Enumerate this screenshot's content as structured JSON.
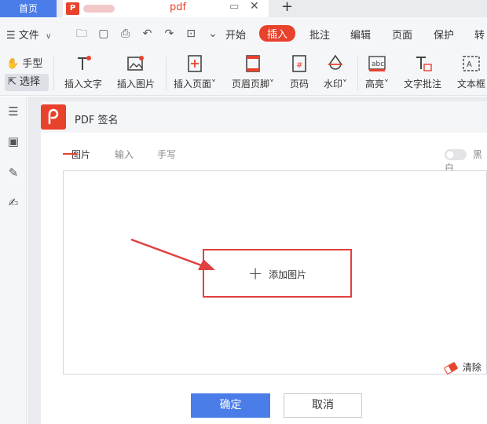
{
  "tabs": {
    "home": "首页",
    "doc_badge": "P",
    "doc_name": "pdf",
    "new_tab": "+"
  },
  "toolbar": {
    "file_menu": "文件",
    "menu_tabs": [
      "开始",
      "插入",
      "批注",
      "编辑",
      "页面",
      "保护",
      "转"
    ],
    "active_tab": "插入"
  },
  "tools": {
    "hand": "手型",
    "select": "选择",
    "items": [
      "插入文字",
      "插入图片",
      "插入页面",
      "页眉页脚",
      "页码",
      "水印",
      "高亮",
      "文字批注",
      "文本框"
    ]
  },
  "dialog": {
    "title": "PDF 签名",
    "tabs": [
      "图片",
      "输入",
      "手写"
    ],
    "toggle_label": "黑白",
    "add_image": "添加图片",
    "clear": "清除",
    "confirm": "确定",
    "cancel": "取消"
  },
  "colors": {
    "accent_red": "#e8412c",
    "primary_blue": "#4a7de8",
    "annotation_red": "#e04040"
  }
}
